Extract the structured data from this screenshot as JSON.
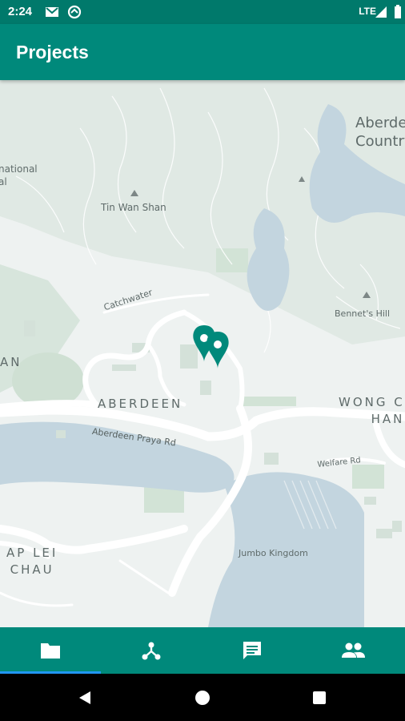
{
  "status_bar": {
    "time": "2:24",
    "network": "LTE",
    "icons": [
      "gmail-icon",
      "sync-icon",
      "signal-icon",
      "battery-icon"
    ]
  },
  "app_bar": {
    "title": "Projects"
  },
  "map": {
    "labels": {
      "aberdeen_country": "Aberde\nCountry",
      "national": "national\nal",
      "tin_wan_shan": "Tin Wan Shan",
      "catchwater": "Catchwater",
      "bennets_hill": "Bennet's Hill",
      "an": "AN",
      "aberdeen": "ABERDEEN",
      "wong_chuk_hang": "WONG CH\nHANG",
      "aberdeen_praya_rd": "Aberdeen Praya Rd",
      "welfare_rd": "Welfare Rd",
      "jumbo_kingdom": "Jumbo Kingdom",
      "ap_lei_chau": "AP LEI\nCHAU"
    },
    "markers": [
      "project-marker",
      "project-marker"
    ],
    "colors": {
      "land": "#eef2f1",
      "water": "#c3d5df",
      "park": "#d5e4da",
      "road": "#ffffff",
      "marker": "#00897b"
    }
  },
  "bottom_nav": {
    "items": [
      {
        "name": "projects",
        "icon": "folder-icon",
        "active": true
      },
      {
        "name": "network",
        "icon": "network-icon",
        "active": false
      },
      {
        "name": "messages",
        "icon": "message-icon",
        "active": false
      },
      {
        "name": "people",
        "icon": "people-icon",
        "active": false
      }
    ],
    "accent": "#2196f3"
  },
  "system_nav": {
    "buttons": [
      "back-icon",
      "home-icon",
      "recents-icon"
    ]
  }
}
